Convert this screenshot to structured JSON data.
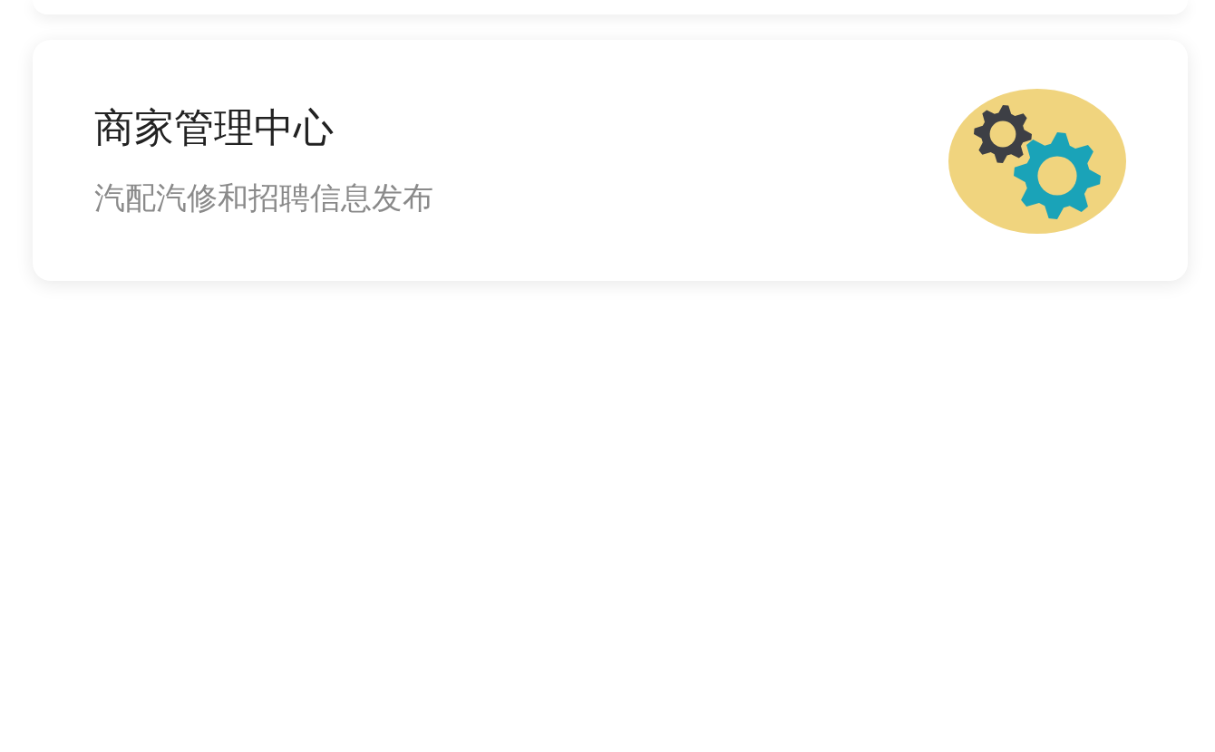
{
  "cards": [
    {
      "title": "商家管理中心",
      "subtitle": "汽配汽修和招聘信息发布",
      "kind": "gears"
    }
  ]
}
